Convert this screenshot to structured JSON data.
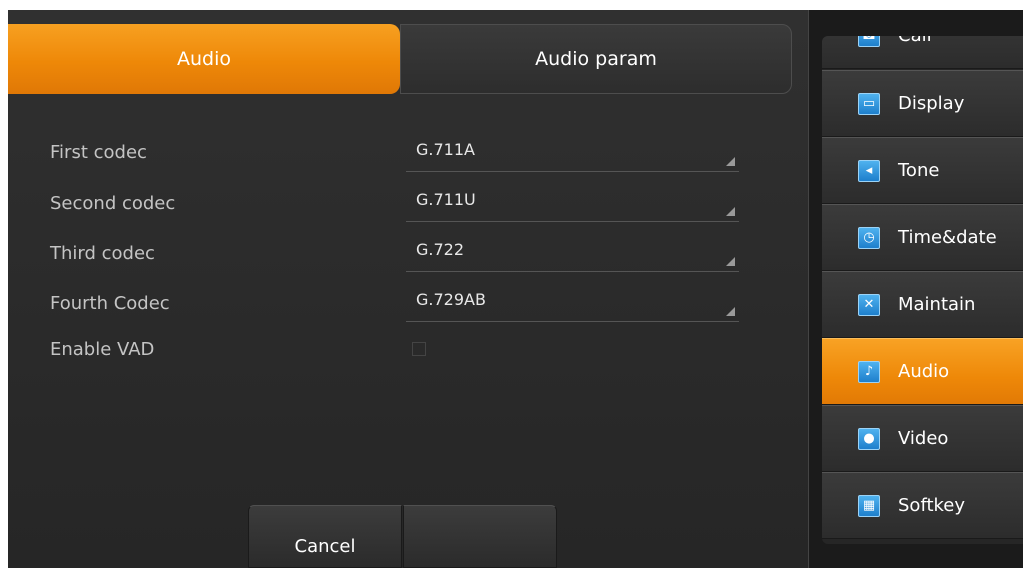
{
  "tabs": [
    {
      "label": "Audio",
      "active": true
    },
    {
      "label": "Audio param",
      "active": false
    }
  ],
  "settings": {
    "first_codec": {
      "label": "First codec",
      "value": "G.711A"
    },
    "second_codec": {
      "label": "Second codec",
      "value": "G.711U"
    },
    "third_codec": {
      "label": "Third codec",
      "value": "G.722"
    },
    "fourth_codec": {
      "label": "Fourth Codec",
      "value": "G.729AB"
    },
    "enable_vad": {
      "label": "Enable VAD",
      "checked": false
    }
  },
  "buttons": {
    "cancel_label": "Cancel",
    "save_label": ""
  },
  "side_menu": {
    "items": [
      {
        "label": "Call",
        "icon": "phone-icon",
        "active": false
      },
      {
        "label": "Display",
        "icon": "monitor-icon",
        "active": false
      },
      {
        "label": "Tone",
        "icon": "speaker-icon",
        "active": false
      },
      {
        "label": "Time&date",
        "icon": "clock-icon",
        "active": false
      },
      {
        "label": "Maintain",
        "icon": "wrench-icon",
        "active": false
      },
      {
        "label": "Audio",
        "icon": "microphone-icon",
        "active": true
      },
      {
        "label": "Video",
        "icon": "camera-icon",
        "active": false
      },
      {
        "label": "Softkey",
        "icon": "keyboard-icon",
        "active": false
      }
    ]
  },
  "colors": {
    "accent": "#EE8808",
    "panel_background": "#2A2A2A",
    "icon_blue": "#2A8FD8"
  }
}
